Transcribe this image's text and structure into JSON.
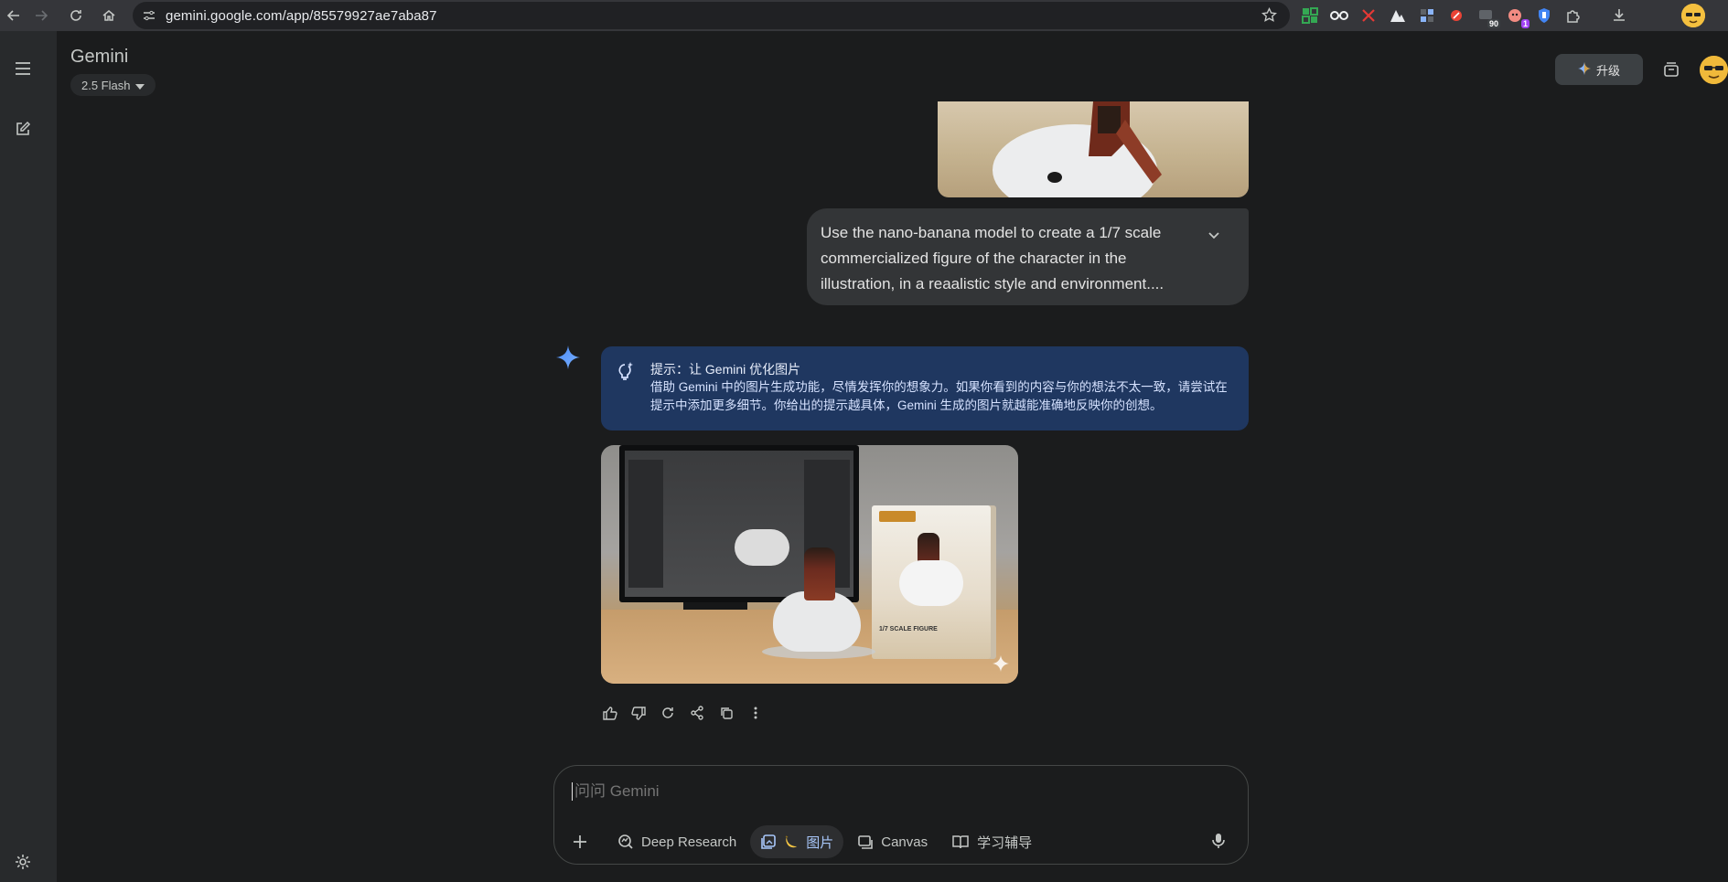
{
  "browser": {
    "url": "gemini.google.com/app/85579927ae7aba87",
    "extensions": [
      {
        "icon": "qr-grid-icon",
        "color": "#34a853"
      },
      {
        "icon": "glasses-icon",
        "color": "#f1f3f4"
      },
      {
        "icon": "cross-icon",
        "color": "#e53935"
      },
      {
        "icon": "mountain-icon",
        "color": "#e8eaed"
      },
      {
        "icon": "grid-icon",
        "color": "#8ab4f8"
      },
      {
        "icon": "no-entry-icon",
        "color": "#ea4335"
      },
      {
        "icon": "tab-counter-icon",
        "color": "#9aa0a6",
        "badge": "90"
      },
      {
        "icon": "mascot-icon",
        "color": "#f28b82",
        "badge": "1"
      },
      {
        "icon": "shield-icon",
        "color": "#4285f4"
      },
      {
        "icon": "puzzle-icon",
        "color": "#c4c7c5"
      },
      {
        "icon": "download-icon",
        "color": "#c4c7c5"
      }
    ]
  },
  "header": {
    "title": "Gemini",
    "model": "2.5 Flash",
    "upgrade_label": "升级"
  },
  "conversation": {
    "user_prompt": "Use the nano-banana model to create a 1/7 scale commercialized figure of the character in the illustration, in a reaalistic style and environment....",
    "tip_title": "提示：让 Gemini 优化图片",
    "tip_body": "借助 Gemini 中的图片生成功能，尽情发挥你的想象力。如果你看到的内容与你的想法不太一致，请尝试在提示中添加更多细节。你给出的提示越具体，Gemini 生成的图片就越能准确地反映你的创想。",
    "image_box_label": "1/7 SCALE FIGURE"
  },
  "composer": {
    "placeholder": "问问 Gemini",
    "tools": [
      {
        "label": "Deep Research",
        "icon": "deep-research-icon",
        "active": false
      },
      {
        "label": "图片",
        "icon": "image-gen-icon",
        "active": true
      },
      {
        "label": "Canvas",
        "icon": "canvas-icon",
        "active": false
      },
      {
        "label": "学习辅导",
        "icon": "learning-icon",
        "active": false
      }
    ]
  },
  "colors": {
    "accent_blue": "#a8c7fa",
    "tip_background": "#1f3760",
    "page_background": "#1b1c1d"
  }
}
